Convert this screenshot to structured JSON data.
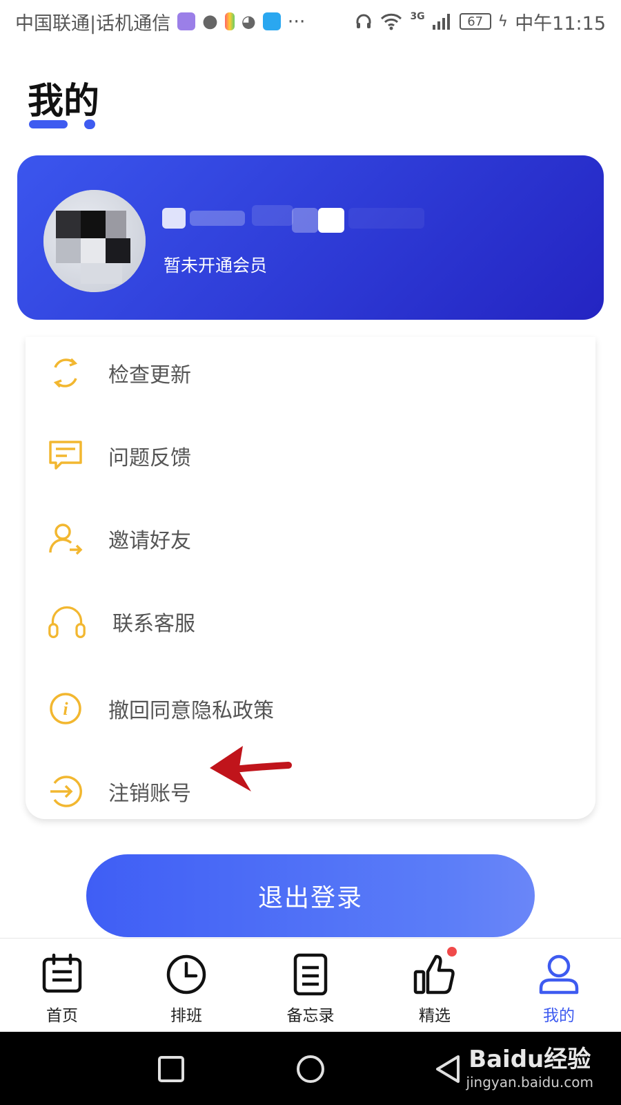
{
  "status_bar": {
    "carrier": "中国联通|话机通信",
    "more": "···",
    "network": "3G",
    "battery": "67",
    "time": "中午11:15"
  },
  "page": {
    "title": "我的"
  },
  "profile": {
    "member_status": "暂未开通会员"
  },
  "menu": {
    "items": [
      {
        "label": "检查更新",
        "icon": "refresh-icon"
      },
      {
        "label": "问题反馈",
        "icon": "feedback-icon"
      },
      {
        "label": "邀请好友",
        "icon": "invite-friend-icon"
      },
      {
        "label": "联系客服",
        "icon": "headphones-icon"
      },
      {
        "label": "撤回同意隐私政策",
        "icon": "info-icon"
      },
      {
        "label": "注销账号",
        "icon": "logout-circle-icon"
      }
    ]
  },
  "logout_button": {
    "label": "退出登录"
  },
  "bottom_nav": {
    "items": [
      {
        "label": "首页",
        "icon": "calendar-icon",
        "active": false
      },
      {
        "label": "排班",
        "icon": "clock-icon",
        "active": false
      },
      {
        "label": "备忘录",
        "icon": "memo-icon",
        "active": false
      },
      {
        "label": "精选",
        "icon": "thumbs-up-icon",
        "active": false
      },
      {
        "label": "我的",
        "icon": "user-icon",
        "active": true
      }
    ]
  },
  "watermark": {
    "brand": "Baidu经验",
    "url": "jingyan.baidu.com"
  },
  "colors": {
    "accent": "#3e5bf0",
    "icon_yellow": "#f2b730",
    "arrow_red": "#c0141b"
  }
}
